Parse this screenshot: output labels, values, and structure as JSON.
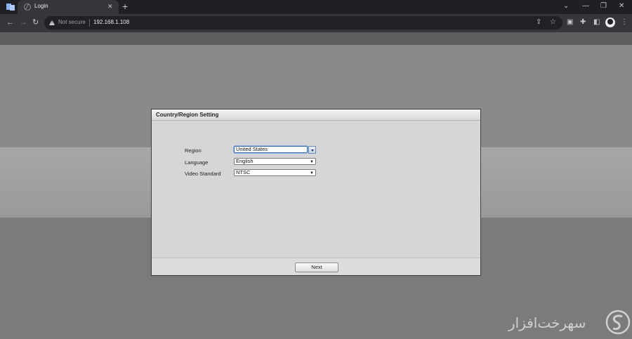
{
  "browser": {
    "tab": {
      "title": "Login"
    },
    "omnibox": {
      "security_label": "Not secure",
      "url": "192.168.1.108"
    }
  },
  "dialog": {
    "title": "Country/Region Setting",
    "fields": [
      {
        "label": "Region",
        "value": "United States"
      },
      {
        "label": "Language",
        "value": "English"
      },
      {
        "label": "Video Standard",
        "value": "NTSC"
      }
    ],
    "next_label": "Next"
  },
  "watermark": {
    "text": "سهر‌خت‌افزار"
  },
  "colors": {
    "dialog_bg": "#d6d6d6",
    "focus_border": "#3b6fb0",
    "browser_dark": "#35363a"
  }
}
